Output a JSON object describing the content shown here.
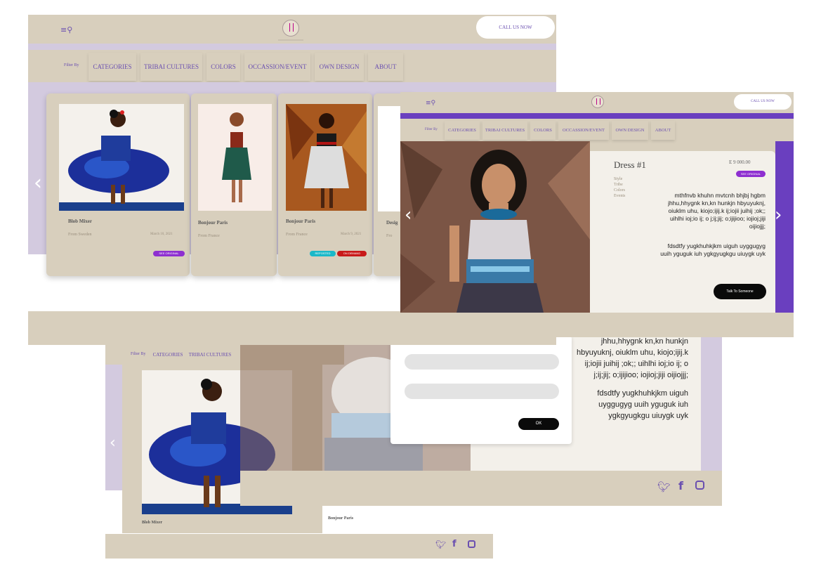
{
  "brand": {
    "accent": "#6a4fb0",
    "beige": "#d8cfbd",
    "lavender": "#d3cadf",
    "purple_panel": "#6a3fbf"
  },
  "header": {
    "call_label": "CALL US NOW"
  },
  "nav": {
    "filter_label": "Filter By",
    "items": [
      "CATEGORIES",
      "TRIBAI CULTURES",
      "COLORS",
      "OCCASSION/EVENT",
      "OWN DESIGN",
      "ABOUT"
    ]
  },
  "cards": [
    {
      "name": "Blob Mixer",
      "from": "From Sweden",
      "date": "March 10, 2021",
      "badge": "SEE ORIGINAL"
    },
    {
      "name": "Bonjour Paris",
      "from": "From France"
    },
    {
      "name": "Bonjour Paris",
      "from": "From France",
      "date": "March 9, 2021",
      "badges": [
        "REPOSTED",
        "ON DEMAND"
      ]
    },
    {
      "name": "Desig",
      "from": "Fro"
    }
  ],
  "detail": {
    "title": "Dress #1",
    "price": "E 9 000.00",
    "badge": "SEE ORIGINAL",
    "specs": [
      "Style",
      "Tribe",
      "Colors",
      "Events"
    ],
    "para1": "mthfnvb khuhn mvtcnh bhjbj hgbm jhhu,hhygnk kn,kn hunkjn hbyuyuknj, oiuklm uhu, kiojo;ijij.k ij;iojii juihij ;ok;; uihlhi ioj;io ij; o j;ij;jij; o;ijijioo; iojioj;jiji oijiojjj;",
    "para2": "fdsdtfy yugkhuhkjkm uiguh uyggugyg uuih yguguk iuh ygkgyugkgu uiuygk uyk",
    "cta": "Talk To Someone"
  },
  "modal": {
    "text1": "jhhu,hhygnk kn,kn hunkjn",
    "text2": "hbyuyuknj, oiuklm uhu, kiojo;ijij.k",
    "text3": "ij;iojii juihij ;ok;; uihlhi ioj;io ij; o",
    "text4": "j;ij;jij; o;ijijioo; iojioj;jiji oijiojjj;",
    "text5": "fdsdtfy yugkhuhkjkm uiguh",
    "text6": "uyggugyg uuih yguguk iuh",
    "text7": "ygkgyugkgu uiuygk uyk",
    "ok": "OK"
  },
  "screen3": {
    "filter_label": "Filter By",
    "nav": [
      "CATEGORIES",
      "TRIBAI CULTURES"
    ],
    "card1": "Blob Mixer",
    "card2": "Bonjour Paris"
  },
  "icons": [
    "twitter-icon",
    "facebook-icon",
    "instagram-icon"
  ]
}
